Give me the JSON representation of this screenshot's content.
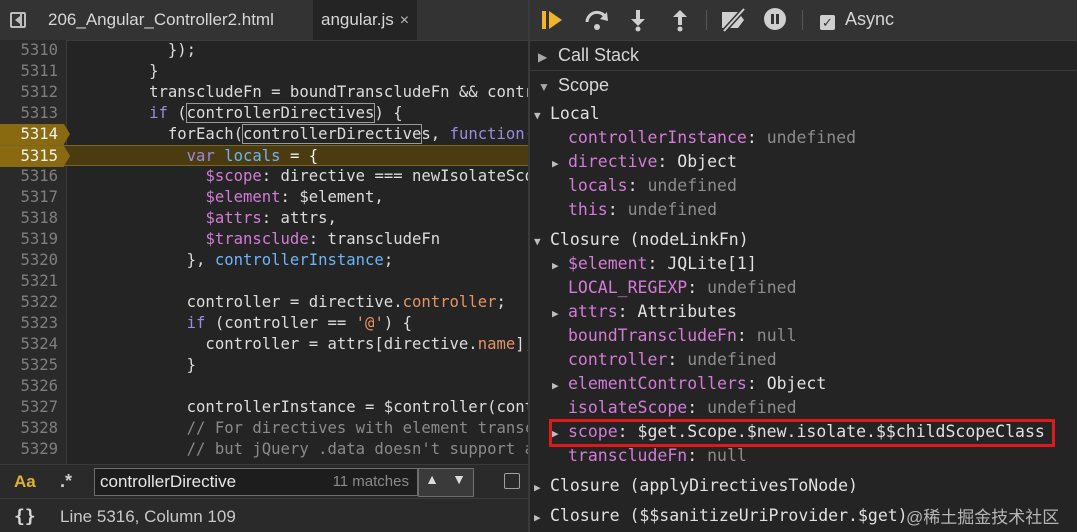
{
  "tabs": [
    {
      "label": "206_Angular_Controller2.html"
    },
    {
      "label": "angular.js",
      "close": "×"
    }
  ],
  "icons": {
    "navigator_toggle": "sidebar-toggle-icon",
    "resume": "resume-icon",
    "step_over": "step-over-icon",
    "step_into": "step-into-icon",
    "step_out": "step-out-icon",
    "deactivate_breakpoints": "deactivate-breakpoints-icon",
    "pause_on_exceptions": "pause-exceptions-icon"
  },
  "code": {
    "lines": [
      {
        "n": "5310",
        "html": "          });"
      },
      {
        "n": "5311",
        "html": "        }"
      },
      {
        "n": "5312",
        "html": "        transcludeFn = boundTranscludeFn &amp;&amp; controllersBoundTransclude;"
      },
      {
        "n": "5313",
        "html": "        <span class='k'>if</span> (<span class='hl'>controllerDirectives</span>) {"
      },
      {
        "n": "5314",
        "bp": true,
        "html": "          forEach(<span class='hl'>controllerDirective</span>s, <span class='k'>function</span>(directive) {"
      },
      {
        "n": "5315",
        "bp": true,
        "exec": true,
        "html": "            <span class='k'>var</span> <span class='b'>locals</span> = {"
      },
      {
        "n": "5316",
        "html": "              <span class='p'>$scope</span>: directive === newIsolateScopeDirective"
      },
      {
        "n": "5317",
        "html": "              <span class='p'>$element</span>: $element,"
      },
      {
        "n": "5318",
        "html": "              <span class='p'>$attrs</span>: attrs,"
      },
      {
        "n": "5319",
        "html": "              <span class='p'>$transclude</span>: transcludeFn"
      },
      {
        "n": "5320",
        "html": "            }, <span class='b'>controllerInstance</span>;"
      },
      {
        "n": "5321",
        "html": ""
      },
      {
        "n": "5322",
        "html": "            controller = directive.<span class='s'>controller</span>;"
      },
      {
        "n": "5323",
        "html": "            <span class='k'>if</span> (controller == <span class='s'>'@'</span>) {"
      },
      {
        "n": "5324",
        "html": "              controller = attrs[directive.<span class='s'>name</span>];"
      },
      {
        "n": "5325",
        "html": "            }"
      },
      {
        "n": "5326",
        "html": ""
      },
      {
        "n": "5327",
        "html": "            controllerInstance = $controller(controller, locals"
      },
      {
        "n": "5328",
        "html": "            <span class='c'>// For directives with element transclusion the</span>"
      },
      {
        "n": "5329",
        "html": "            <span class='c'>// but jQuery .data doesn't support attaching</span>"
      }
    ]
  },
  "search": {
    "case_label": "Aa",
    "regex_label": ".*",
    "query": "controllerDirective",
    "matches": "11 matches",
    "up": "▲",
    "down": "▼"
  },
  "status": {
    "braces": "{}",
    "position": "Line 5316, Column 109"
  },
  "debugger": {
    "async_label": "Async",
    "call_stack_label": "Call Stack",
    "scope_label": "Scope",
    "local_label": "Local",
    "closure1_label": "Closure (nodeLinkFn)",
    "closure2_label": "Closure (applyDirectivesToNode)",
    "closure3_label": "Closure ($$sanitizeUriProvider.$get)",
    "local": [
      {
        "name": "controllerInstance",
        "value": "undefined",
        "undef": true
      },
      {
        "name": "directive",
        "value": "Object",
        "expand": true
      },
      {
        "name": "locals",
        "value": "undefined",
        "undef": true
      },
      {
        "name": "this",
        "value": "undefined",
        "undef": true
      }
    ],
    "closure": [
      {
        "name": "$element",
        "value": "JQLite[1]",
        "expand": true
      },
      {
        "name": "LOCAL_REGEXP",
        "value": "undefined",
        "undef": true
      },
      {
        "name": "attrs",
        "value": "Attributes",
        "expand": true
      },
      {
        "name": "boundTranscludeFn",
        "value": "null",
        "undef": true
      },
      {
        "name": "controller",
        "value": "undefined",
        "undef": true
      },
      {
        "name": "elementControllers",
        "value": "Object",
        "expand": true
      },
      {
        "name": "isolateScope",
        "value": "undefined",
        "undef": true
      },
      {
        "name": "scope",
        "value": "$get.Scope.$new.isolate.$$childScopeClass",
        "expand": true
      },
      {
        "name": "transcludeFn",
        "value": "null",
        "undef": true
      }
    ]
  },
  "watermark": "@稀土掘金技术社区"
}
